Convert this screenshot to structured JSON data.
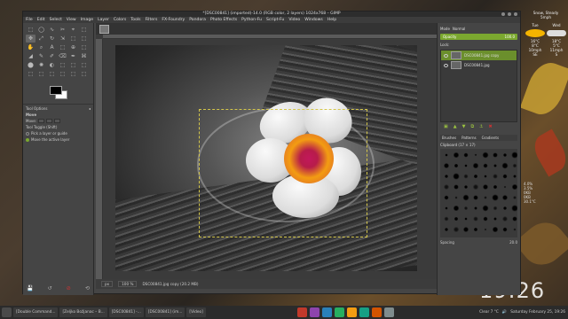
{
  "window": {
    "title": "*[DSC00841] (imported)-14.0 (RGB color, 2 layers) 1024x768 – GIMP",
    "menu": [
      "File",
      "Edit",
      "Select",
      "View",
      "Image",
      "Layer",
      "Colors",
      "Tools",
      "Filters",
      "FX-Foundry",
      "Pandora",
      "Photo Effects",
      "Python-Fu",
      "Script-Fu",
      "Video",
      "Windows",
      "Help"
    ]
  },
  "toolbox": {
    "tools": [
      "⬚",
      "◯",
      "∿",
      "✂",
      "⌖",
      "⬚",
      "✥",
      "⤢",
      "↻",
      "⇲",
      "⬚",
      "⬚",
      "✋",
      "⌕",
      "A",
      "⬚",
      "⊕",
      "⬚",
      "◢",
      "✎",
      "✐",
      "⌫",
      "✒",
      "⌘",
      "⬤",
      "✺",
      "◐",
      "⬚",
      "⬚",
      "⬚",
      "⬚",
      "⬚",
      "⬚",
      "⬚",
      "⬚",
      "⬚"
    ],
    "options_title": "Tool Options",
    "tool_name": "Move",
    "move_label": "Move:",
    "toggle_label": "Tool Toggle (Shift)",
    "option_pick": "Pick a layer or guide",
    "option_move_active": "Move the active layer"
  },
  "canvas": {
    "zoom_unit": "px",
    "zoom": "100 %",
    "status": "DSC00841.jpg copy (20.2 MB)"
  },
  "dock": {
    "mode_label": "Mode",
    "mode_value": "Normal",
    "opacity_label": "Opacity",
    "opacity_value": "100.0",
    "lock_label": "Lock:",
    "layers": [
      {
        "name": "DSC00841.jpg copy",
        "selected": true
      },
      {
        "name": "DSC00841.jpg",
        "selected": false
      }
    ],
    "tabs": [
      "Brushes",
      "Patterns",
      "Gradients"
    ],
    "brush_name": "Clipboard (17 × 17)",
    "spacing_label": "Spacing",
    "spacing_value": "20.0"
  },
  "weather": {
    "header": "Snow, Steady",
    "sub": "5mph",
    "days": [
      {
        "day": "Tue",
        "hi": "16°C",
        "lo": "8°C",
        "wind": "10mph",
        "dir": "SE"
      },
      {
        "day": "Wed",
        "hi": "18°C",
        "lo": "5°C",
        "wind": "11mph",
        "dir": "S"
      }
    ]
  },
  "sysinfo": {
    "line1": "4.0%",
    "line2": "3.5%",
    "line3": "0KB",
    "line4": "0KB",
    "line5": "30.1°C"
  },
  "clock": "19:26",
  "taskbar": {
    "tasks": [
      "[Double Command...",
      "[Zeljko Božjanac – B...",
      "[DSC00841] -...",
      "[DSC00841] (im...",
      "[Video]"
    ],
    "tray_temp": "Clear 7 °C",
    "date": "Saturday February 25, 19:26"
  },
  "colors": {
    "accent": "#7ba82f",
    "fg": "#000000",
    "bg": "#ffffff"
  }
}
